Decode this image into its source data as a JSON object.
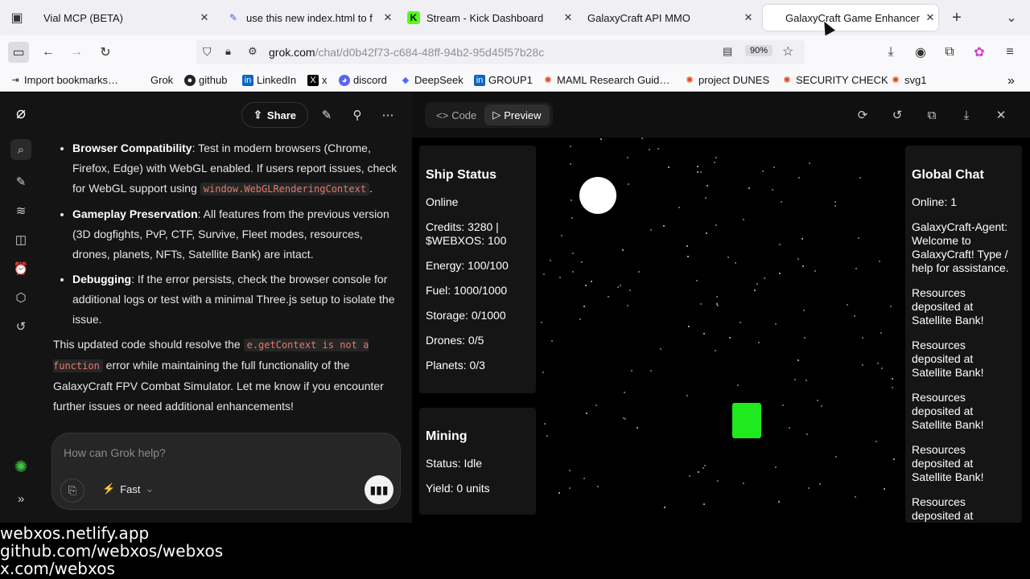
{
  "browser": {
    "tabs": [
      {
        "title": "Vial MCP (BETA)",
        "icon": "page-icon"
      },
      {
        "title": "use this new index.html to f",
        "icon": "chat-icon"
      },
      {
        "title": "Stream - Kick Dashboard",
        "icon": "kick-icon"
      },
      {
        "title": "GalaxyCraft API MMO",
        "icon": "none"
      },
      {
        "title": "GalaxyCraft Game Enhancer",
        "icon": "none",
        "active": true
      }
    ],
    "url_domain": "grok.com",
    "url_path": "/chat/d0b42f73-c684-48ff-94b2-95d45f57b28c",
    "zoom": "90%",
    "bookmarks": [
      "Import bookmarks…",
      "Grok",
      "github",
      "LinkedIn",
      "x",
      "discord",
      "DeepSeek",
      "GROUP1",
      "MAML Research Guid…",
      "project DUNES",
      "SECURITY CHECK",
      "svg1"
    ]
  },
  "chat": {
    "share_label": "Share",
    "bullets": [
      {
        "title": "Browser Compatibility",
        "text": ": Test in modern browsers (Chrome, Firefox, Edge) with WebGL enabled. If users report issues, check for WebGL support using ",
        "code": "window.WebGLRenderingContext",
        "tail": "."
      },
      {
        "title": "Gameplay Preservation",
        "text": ": All features from the previous version (3D dogfights, PvP, CTF, Survive, Fleet modes, resources, drones, planets, NFTs, Satellite Bank) are intact."
      },
      {
        "title": "Debugging",
        "text": ": If the error persists, check the browser console for additional logs or test with a minimal Three.js setup to isolate the issue."
      }
    ],
    "conclusion_pre": "This updated code should resolve the ",
    "conclusion_code": "e.getContext is not a function",
    "conclusion_post": " error while maintaining the full functionality of the GalaxyCraft FPV Combat Simulator. Let me know if you encounter further issues or need additional enhancements!",
    "input_placeholder": "How can Grok help?",
    "model_label": "Fast"
  },
  "artifact": {
    "tab_code": "Code",
    "tab_preview": "Preview"
  },
  "game": {
    "ship_status": {
      "title": "Ship Status",
      "rows": [
        "Online",
        "Credits: 3280 | $WEBXOS: 100",
        "Energy: 100/100",
        "Fuel: 1000/1000",
        "Storage: 0/1000",
        "Drones: 0/5",
        "Planets: 0/3"
      ]
    },
    "mining": {
      "title": "Mining",
      "rows": [
        "Status: Idle",
        "Yield: 0 units"
      ]
    },
    "global_chat": {
      "title": "Global Chat",
      "rows": [
        "Online: 1",
        "GalaxyCraft-Agent: Welcome to GalaxyCraft! Type / help for assistance.",
        "Resources deposited at Satellite Bank!",
        "Resources deposited at Satellite Bank!",
        "Resources deposited at Satellite Bank!",
        "Resources deposited at Satellite Bank!",
        "Resources deposited at"
      ]
    }
  },
  "overlay": [
    "webxos.netlify.app",
    "github.com/webxos/webxos",
    "x.com/webxos"
  ],
  "colors": {
    "ship": "#1eea1e",
    "moon": "#ffffff",
    "panel": "#151515"
  }
}
